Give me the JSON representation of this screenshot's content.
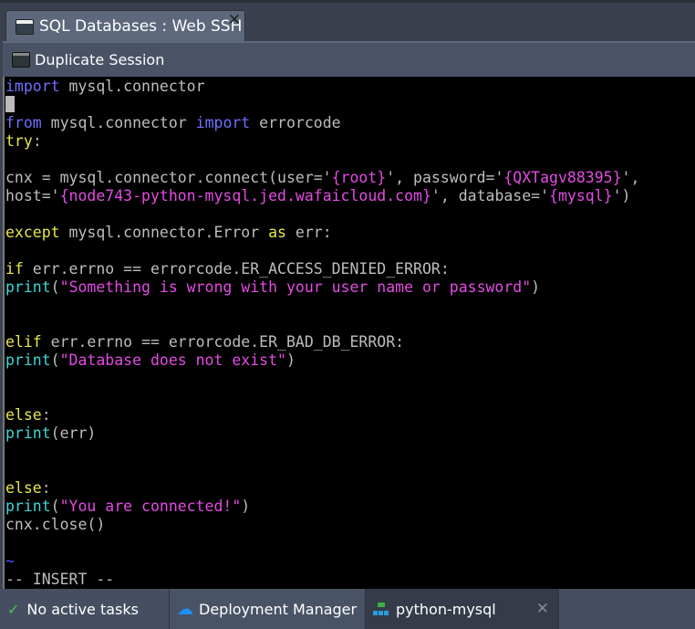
{
  "window": {
    "tab_title": "SQL Databases : Web SSH",
    "close": "✕"
  },
  "toolbar": {
    "duplicate_label": "Duplicate Session"
  },
  "terminal": {
    "lines": [
      [
        [
          "import",
          "kw"
        ],
        [
          " mysql.connector",
          "g"
        ]
      ],
      [
        [
          "__CURSOR__",
          ""
        ]
      ],
      [
        [
          "from",
          "kw"
        ],
        [
          " mysql.connector ",
          "g"
        ],
        [
          "import",
          "kw"
        ],
        [
          " errorcode",
          "g"
        ]
      ],
      [
        [
          "try",
          "y"
        ],
        [
          ":",
          "g"
        ]
      ],
      [],
      [
        [
          "cnx = mysql.connector.connect(user='",
          "g"
        ],
        [
          "{root}",
          "m"
        ],
        [
          "', password='",
          "g"
        ],
        [
          "{QXTagv88395}",
          "m"
        ],
        [
          "',",
          "g"
        ]
      ],
      [
        [
          "host='",
          "g"
        ],
        [
          "{node743-python-mysql.jed.wafaicloud.com}",
          "m"
        ],
        [
          "', database='",
          "g"
        ],
        [
          "{mysql}",
          "m"
        ],
        [
          "')",
          "g"
        ]
      ],
      [],
      [
        [
          "except",
          "y"
        ],
        [
          " mysql.connector.Error ",
          "g"
        ],
        [
          "as",
          "y"
        ],
        [
          " err:",
          "g"
        ]
      ],
      [],
      [
        [
          "if",
          "y"
        ],
        [
          " err.errno == errorcode.ER_ACCESS_DENIED_ERROR:",
          "g"
        ]
      ],
      [
        [
          "print",
          "c"
        ],
        [
          "(",
          "g"
        ],
        [
          "\"Something is wrong with your user name or password\"",
          "m"
        ],
        [
          ")",
          "g"
        ]
      ],
      [],
      [],
      [
        [
          "elif",
          "y"
        ],
        [
          " err.errno == errorcode.ER_BAD_DB_ERROR:",
          "g"
        ]
      ],
      [
        [
          "print",
          "c"
        ],
        [
          "(",
          "g"
        ],
        [
          "\"Database does not exist\"",
          "m"
        ],
        [
          ")",
          "g"
        ]
      ],
      [],
      [],
      [
        [
          "else",
          "y"
        ],
        [
          ":",
          "g"
        ]
      ],
      [
        [
          "print",
          "c"
        ],
        [
          "(err)",
          "g"
        ]
      ],
      [],
      [],
      [
        [
          "else",
          "y"
        ],
        [
          ":",
          "g"
        ]
      ],
      [
        [
          "print",
          "c"
        ],
        [
          "(",
          "g"
        ],
        [
          "\"You are connected!\"",
          "m"
        ],
        [
          ")",
          "g"
        ]
      ],
      [
        [
          "cnx.close()",
          "g"
        ]
      ],
      [],
      [
        [
          "~",
          "t"
        ]
      ],
      [
        [
          "-- INSERT --",
          "g"
        ]
      ]
    ]
  },
  "statusbar": {
    "tasks": "No active tasks",
    "deployment": "Deployment Manager",
    "env": "python-mysql",
    "env_close": "✕"
  },
  "colors": {
    "keyword": "#6f6fff",
    "control": "#e6e64a",
    "builtin": "#3ed6d6",
    "string": "#e44be4"
  }
}
